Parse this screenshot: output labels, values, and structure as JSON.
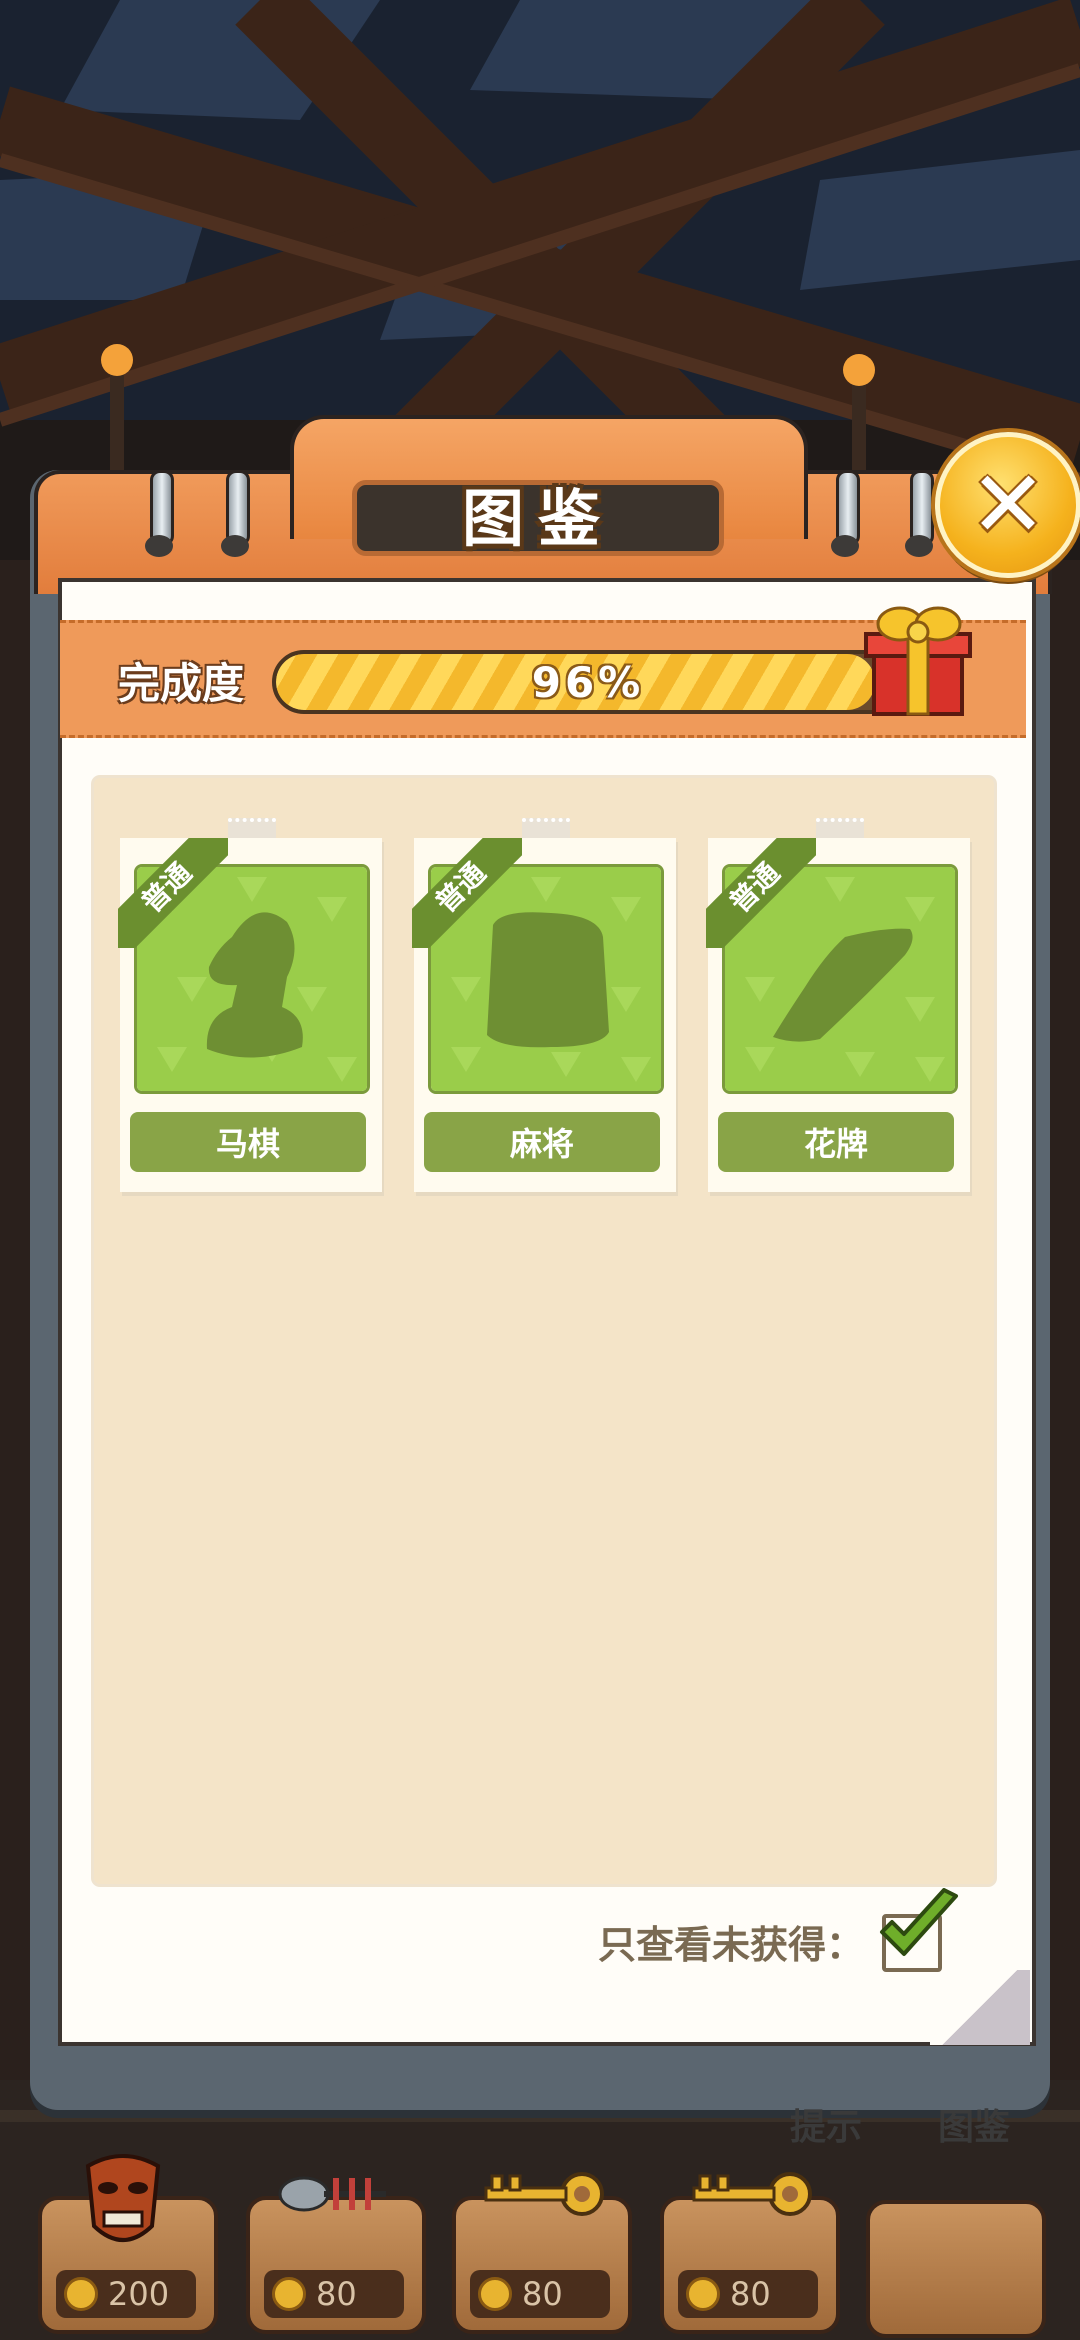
{
  "title": "图鉴",
  "progress": {
    "label": "完成度",
    "percent": 0.96,
    "text": "96%"
  },
  "cards": [
    {
      "badge": "普通",
      "name": "马棋",
      "icon": "knight-silhouette-icon"
    },
    {
      "badge": "普通",
      "name": "麻将",
      "icon": "mahjong-tile-silhouette-icon"
    },
    {
      "badge": "普通",
      "name": "花牌",
      "icon": "card-silhouette-icon"
    }
  ],
  "filter": {
    "label": "只查看未获得：",
    "checked": true
  },
  "bottom_bar": {
    "hint_label": "提示",
    "gallery_label": "图鉴",
    "items": [
      {
        "icon": "mask-icon",
        "price": "200"
      },
      {
        "icon": "fish-bone-icon",
        "price": "80"
      },
      {
        "icon": "key-icon",
        "price": "80"
      },
      {
        "icon": "key-icon",
        "price": "80"
      },
      {
        "icon": "empty-slot",
        "price": ""
      }
    ]
  },
  "colors": {
    "card_green": "#9acd4a",
    "badge_green": "#6b8f2f",
    "panel_orange": "#e8863f",
    "progress_gold": "#f4b82c"
  }
}
